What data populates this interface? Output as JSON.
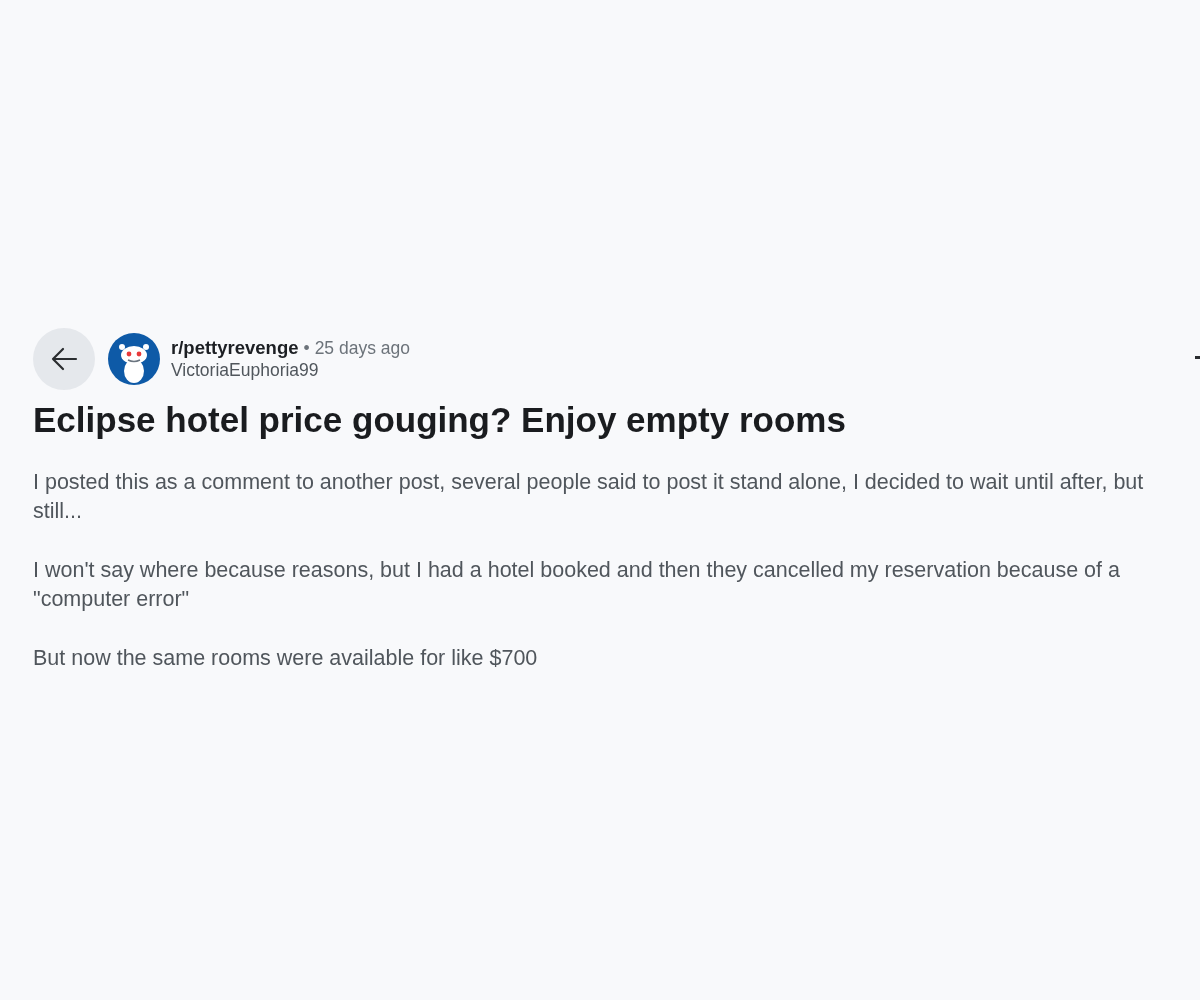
{
  "post_header": {
    "subreddit": "r/pettyrevenge",
    "separator": "•",
    "time": "25 days ago",
    "author": "VictoriaEuphoria99"
  },
  "post": {
    "title": "Eclipse hotel price gouging? Enjoy empty rooms",
    "paragraphs": [
      "I posted this as a comment to another post, several people said to post it stand alone, I decided to wait until after, but still...",
      "I won't say where because reasons, but I had a hotel booked and then they cancelled my reservation because of a \"computer error\"",
      "But now the same rooms were available for like $700"
    ]
  }
}
